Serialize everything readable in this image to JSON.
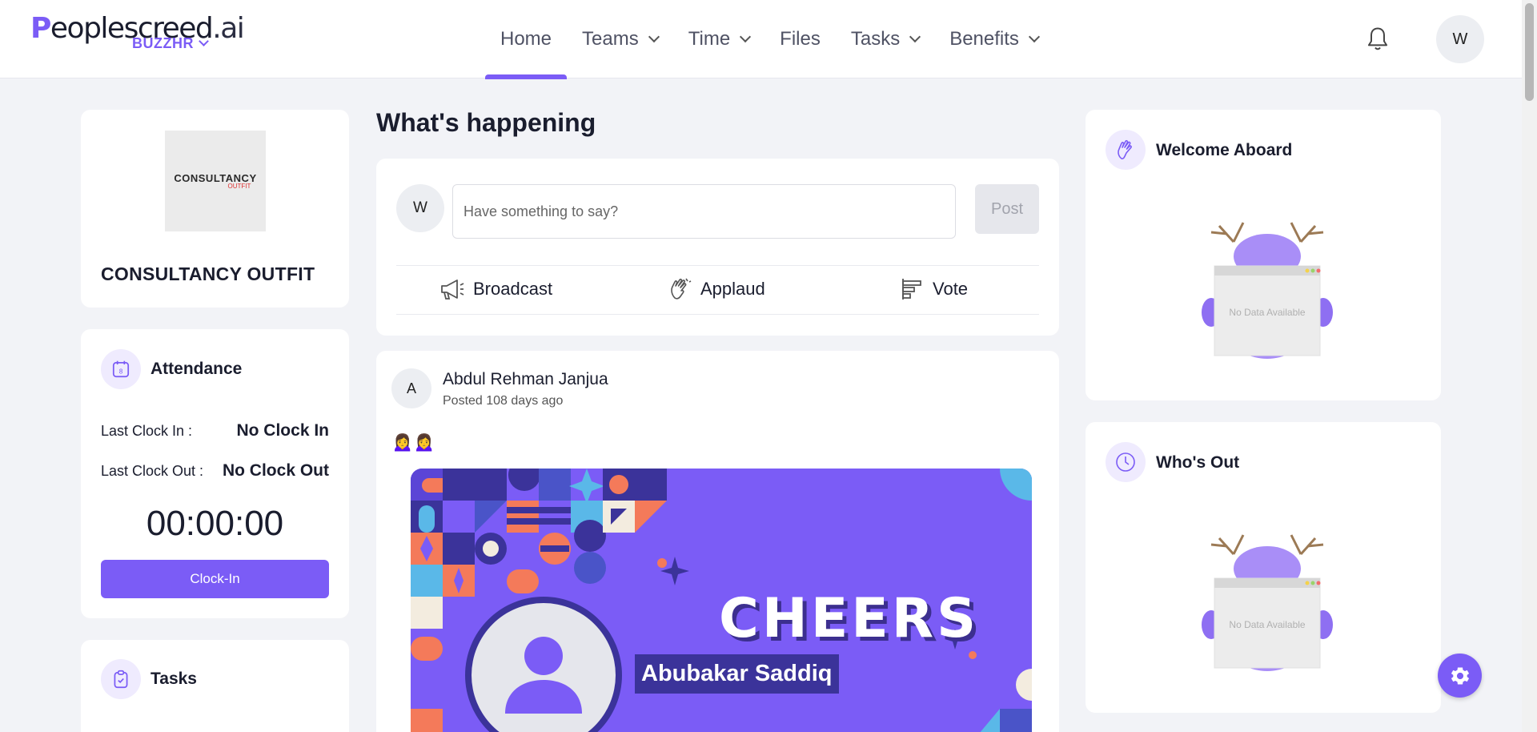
{
  "brand": {
    "name_head": "P",
    "name_mid": "eoplescreed",
    "name_tail": ".ai",
    "workspace": "BUZZHR"
  },
  "nav": {
    "items": [
      {
        "label": "Home",
        "has_dropdown": false,
        "active": true
      },
      {
        "label": "Teams",
        "has_dropdown": true
      },
      {
        "label": "Time",
        "has_dropdown": true
      },
      {
        "label": "Files",
        "has_dropdown": false
      },
      {
        "label": "Tasks",
        "has_dropdown": true
      },
      {
        "label": "Benefits",
        "has_dropdown": true
      }
    ],
    "user_initial": "W"
  },
  "company": {
    "logo_line1": "CONSULTANCY",
    "logo_line2": "OUTFIT",
    "name": "CONSULTANCY OUTFIT"
  },
  "attendance": {
    "title": "Attendance",
    "last_in_label": "Last Clock In :",
    "last_in_value": "No Clock In",
    "last_out_label": "Last Clock Out :",
    "last_out_value": "No Clock Out",
    "timer": "00:00:00",
    "button": "Clock-In"
  },
  "tasks": {
    "title": "Tasks"
  },
  "feed": {
    "section_title": "What's happening",
    "composer": {
      "avatar_initial": "W",
      "placeholder": "Have something to say?",
      "post_label": "Post",
      "actions": [
        {
          "label": "Broadcast",
          "icon": "megaphone-icon"
        },
        {
          "label": "Applaud",
          "icon": "clap-icon"
        },
        {
          "label": "Vote",
          "icon": "poll-icon"
        }
      ]
    },
    "post": {
      "author_initial": "A",
      "author": "Abdul Rehman Janjua",
      "time": "Posted 108 days ago",
      "emoji": "🙍‍♀️🙍‍♀️",
      "banner_title": "CHEERS",
      "banner_name": "Abubakar Saddiq"
    }
  },
  "widgets": {
    "welcome": {
      "title": "Welcome Aboard",
      "empty_text": "No Data Available"
    },
    "whos_out": {
      "title": "Who's Out",
      "empty_text": "No Data Available"
    }
  },
  "colors": {
    "accent": "#7b5cf6",
    "banner_name_bg": "#3b339a",
    "background": "#f2f3f7"
  }
}
